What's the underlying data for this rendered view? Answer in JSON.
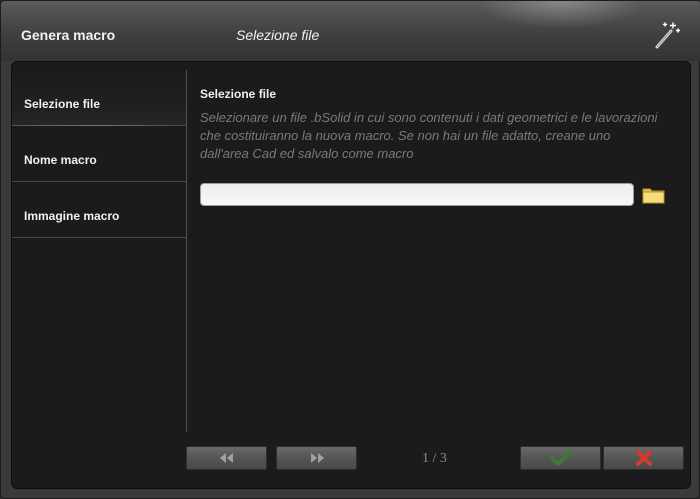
{
  "window": {
    "title": "Genera macro",
    "step_title": "Selezione file"
  },
  "sidebar": {
    "items": [
      {
        "label": "Selezione file",
        "active": true
      },
      {
        "label": "Nome macro",
        "active": false
      },
      {
        "label": "Immagine macro",
        "active": false
      }
    ]
  },
  "panel": {
    "title": "Selezione file",
    "description": "Selezionare un file .bSolid in cui sono contenuti i dati geometrici e le lavorazioni che costituiranno la nuova macro. Se non hai un file adatto, creane uno dall'area Cad ed salvalo come macro",
    "file_value": ""
  },
  "footer": {
    "page_indicator": "1 / 3"
  },
  "icons": {
    "window_icon": "magic-wand-icon",
    "browse": "folder-icon",
    "prev": "double-left-arrow-icon",
    "next": "double-right-arrow-icon",
    "confirm": "check-icon",
    "cancel": "close-x-icon"
  },
  "colors": {
    "confirm_green": "#3f7a32",
    "cancel_red": "#d83a2a",
    "folder_yellow": "#f2d46a"
  }
}
